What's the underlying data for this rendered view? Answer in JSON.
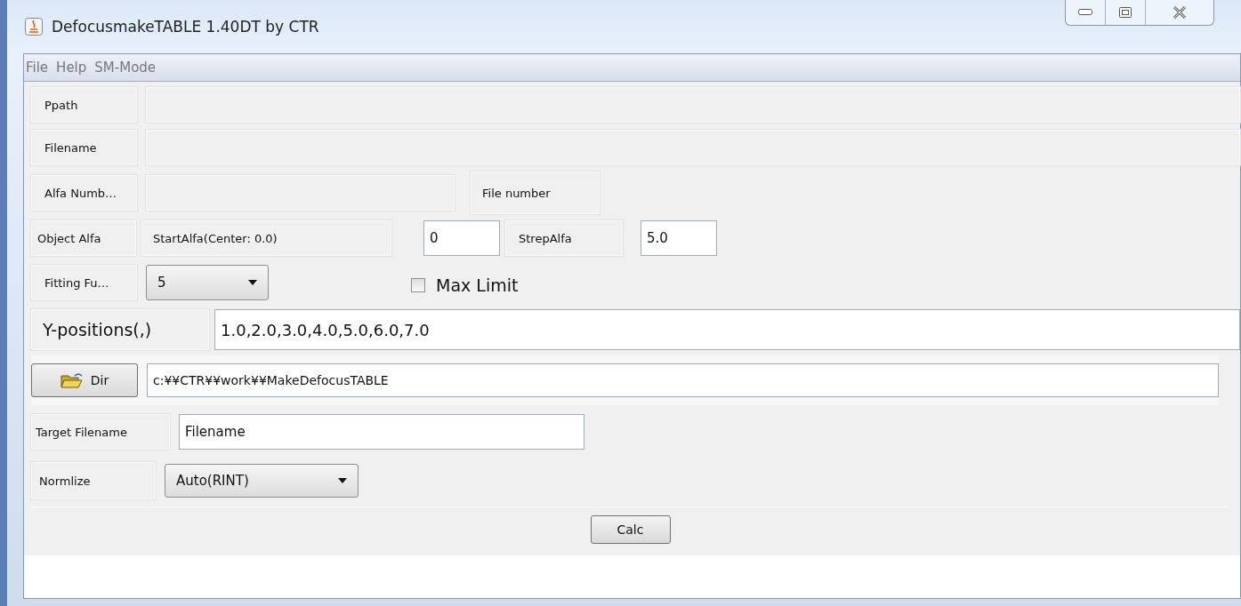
{
  "window": {
    "title": "DefocusmakeTABLE 1.40DT by CTR"
  },
  "menu": [
    "File",
    "Help",
    "SM-Mode"
  ],
  "ppath": {
    "label": "Ppath"
  },
  "filename": {
    "label": "Filename"
  },
  "alfa_number": {
    "label": "Alfa Numb…",
    "file_number_label": "File number"
  },
  "object_alfa": {
    "label": "Object Alfa",
    "start_label": "StartAlfa(Center: 0.0)",
    "start_value": "0",
    "step_label": "StrepAlfa",
    "step_value": "5.0"
  },
  "fitting": {
    "label": "Fitting Fu…",
    "value": "5",
    "max_limit": {
      "label": "Max Limit",
      "checked": false
    }
  },
  "y_positions": {
    "label": "Y-positions(,)",
    "value": "1.0,2.0,3.0,4.0,5.0,6.0,7.0"
  },
  "dir": {
    "button": "Dir",
    "value": "c:¥¥CTR¥¥work¥¥MakeDefocusTABLE"
  },
  "target_filename": {
    "label": "Target Filename",
    "value": "Filename"
  },
  "normalize": {
    "label": "Normlize",
    "value": "Auto(RINT)"
  },
  "buttons": [
    "Calc"
  ]
}
